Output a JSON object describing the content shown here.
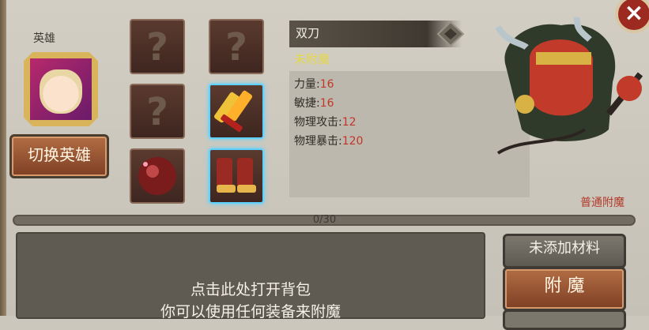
{
  "hero": {
    "label": "英雄",
    "switch_button": "切换英雄"
  },
  "slots": [
    {
      "name": "empty-slot-1",
      "icon": "question-mark-icon"
    },
    {
      "name": "empty-slot-2",
      "icon": "question-mark-icon"
    },
    {
      "name": "empty-slot-3",
      "icon": "question-mark-icon"
    },
    {
      "name": "weapon-slot",
      "icon": "double-blade-icon",
      "active": true
    },
    {
      "name": "orb-slot",
      "icon": "red-orb-icon"
    },
    {
      "name": "boots-slot",
      "icon": "armor-boots-icon"
    }
  ],
  "weapon": {
    "name": "双刀",
    "status": "未附魔",
    "type_icon": "weapon-type-icon",
    "stats": [
      {
        "label": "力量:",
        "value": "16"
      },
      {
        "label": "敏捷:",
        "value": "16"
      },
      {
        "label": "物理攻击:",
        "value": "12"
      },
      {
        "label": "物理暴击:",
        "value": "120"
      }
    ],
    "enchant_type": "普通附魔"
  },
  "progress": {
    "text": "0/30",
    "fraction": 0
  },
  "bag": {
    "line1": "点击此处打开背包",
    "line2": "你可以使用任何装备来附魔"
  },
  "buttons": {
    "material": "未添加材料",
    "enchant": "附  魔"
  },
  "close_icon": "close-icon",
  "colors": {
    "stat_value": "#c0372a",
    "status_yellow": "#e5d84a",
    "enchant_red": "#b23b2a",
    "button_brown": "#9a5635"
  }
}
